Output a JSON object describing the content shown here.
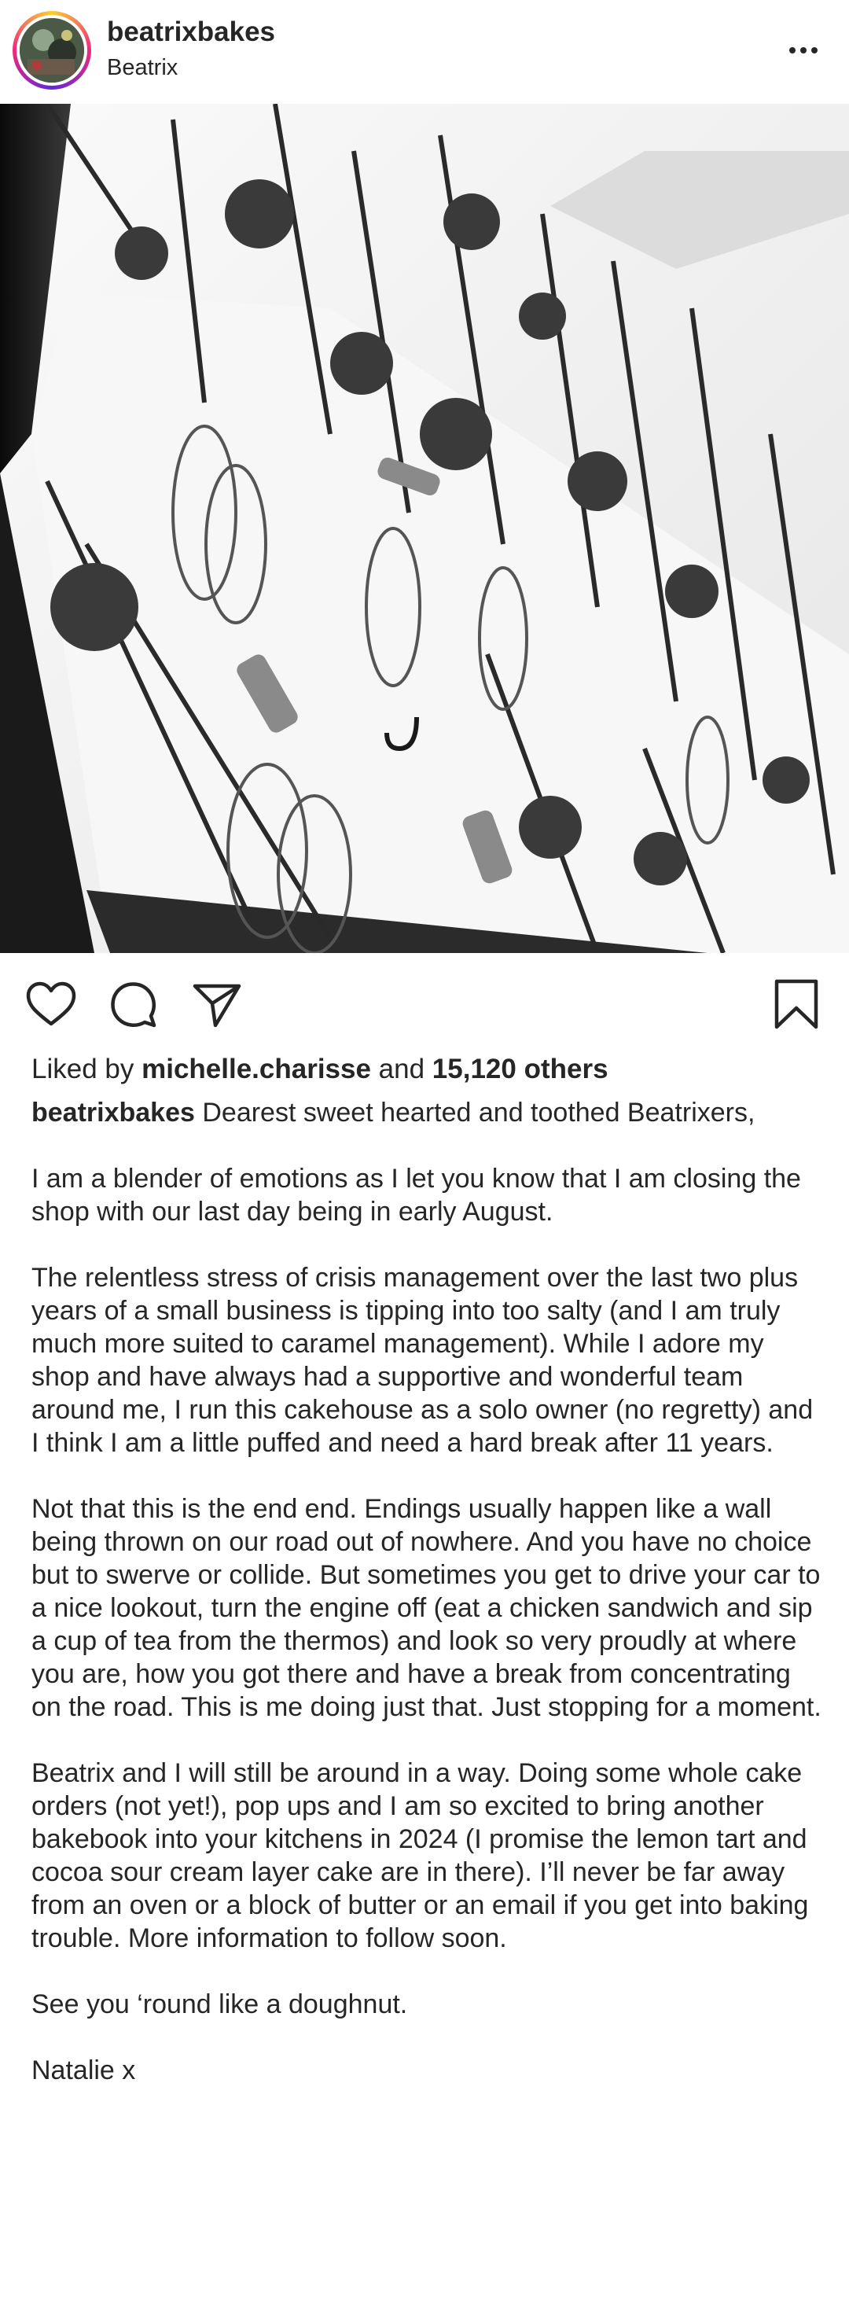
{
  "header": {
    "username": "beatrixbakes",
    "subname": "Beatrix",
    "avatar_icon": "profile-avatar",
    "more_icon": "more-options-icon"
  },
  "post": {
    "image_description_icon": "post-photo"
  },
  "actions": {
    "like_icon": "heart-icon",
    "comment_icon": "comment-icon",
    "share_icon": "send-icon",
    "save_icon": "bookmark-icon"
  },
  "likes": {
    "prefix": "Liked by ",
    "user": "michelle.charisse",
    "middle": " and ",
    "count": "15,120 others"
  },
  "caption": {
    "username": "beatrixbakes",
    "first": " Dearest sweet hearted and toothed Beatrixers,",
    "paragraphs": [
      "I am a blender of emotions as I let you know that I am closing the shop with our last day being in early August.",
      "The relentless stress of crisis management over the last two plus years of a small business is tipping into too salty (and I am truly much more suited to caramel management). While I adore my shop and have always had a supportive and wonderful team around me, I run this cakehouse as a solo owner (no regretty) and I think I am a little puffed and need a hard break after 11 years.",
      "Not that this is the end end. Endings usually happen like a wall being thrown on our road out of nowhere. And you have no choice but to swerve or collide. But sometimes you get to drive your car to a nice lookout, turn the engine off (eat a chicken sandwich and sip a cup of tea from the thermos) and look so very proudly at where you are, how you got there and have a break from concentrating on the road.  This is me doing just that. Just stopping for a moment.",
      "Beatrix and I will still be around in a way. Doing some whole cake orders (not yet!), pop ups and I am so excited to bring another bakebook into your kitchens in 2024 (I promise the lemon tart and cocoa sour cream layer cake are in there). I’ll never be far away from an oven or a block of butter or an email if you get into baking trouble. More information to follow soon.",
      "See you ‘round like a doughnut.",
      "Natalie x"
    ]
  }
}
